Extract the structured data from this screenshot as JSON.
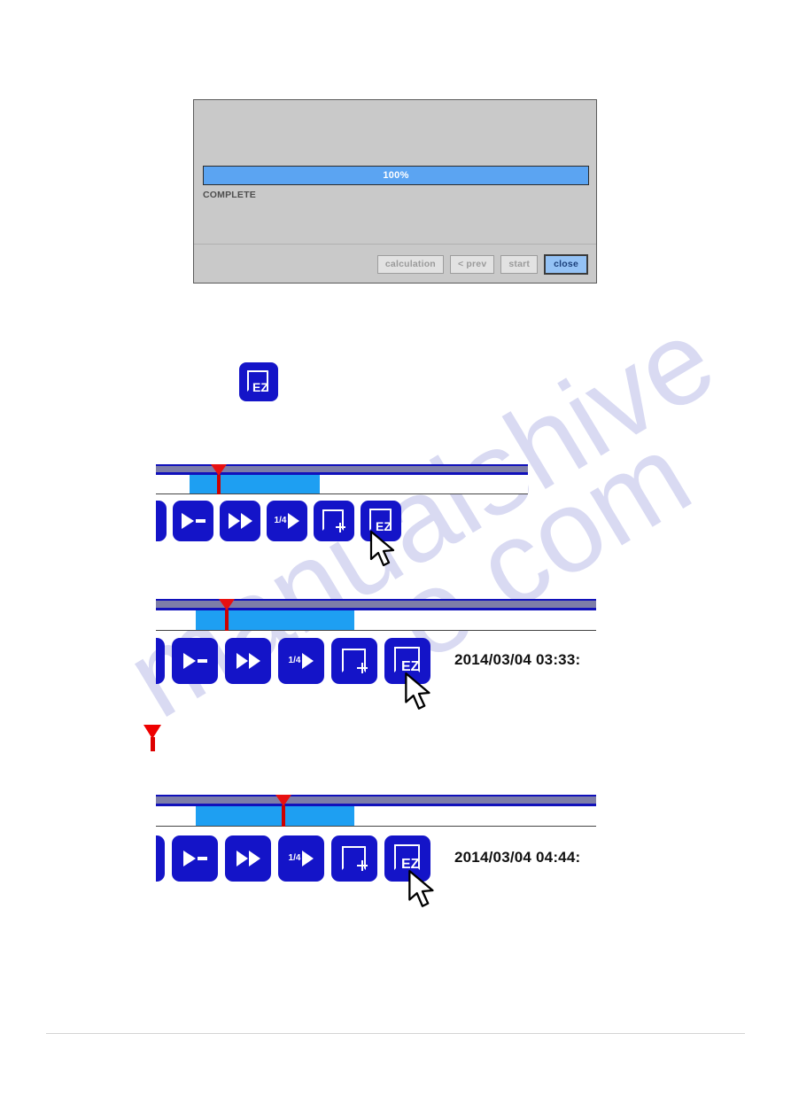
{
  "watermark": {
    "line1": "manualshive",
    "line2": "e.com"
  },
  "dialog": {
    "progress": {
      "percent_label": "100%",
      "percent_value": 100,
      "fill_color": "#5ba4f2"
    },
    "status_text": "COMPLETE",
    "buttons": [
      {
        "label": "calculation",
        "state": "disabled"
      },
      {
        "label": "< prev",
        "state": "disabled"
      },
      {
        "label": "start",
        "state": "disabled"
      },
      {
        "label": "close",
        "state": "focused"
      }
    ]
  },
  "ez_icon": {
    "label": "EZ"
  },
  "toolbars": [
    {
      "id": "toolbar-1",
      "buttons": [
        {
          "name": "play-step-button",
          "glyph": "play-dash-icon",
          "label": ""
        },
        {
          "name": "fast-forward-button",
          "glyph": "fast-forward-icon",
          "label": ""
        },
        {
          "name": "quarter-speed-button",
          "glyph": "quarter-play-icon",
          "label": "1/4"
        },
        {
          "name": "frame-add-button",
          "glyph": "frame-plus-icon",
          "label": "+"
        },
        {
          "name": "ez-button",
          "glyph": "ez-icon",
          "label": "EZ"
        }
      ],
      "timestamp": ""
    },
    {
      "id": "toolbar-2",
      "buttons": [
        {
          "name": "play-step-button",
          "glyph": "play-dash-icon",
          "label": ""
        },
        {
          "name": "fast-forward-button",
          "glyph": "fast-forward-icon",
          "label": ""
        },
        {
          "name": "quarter-speed-button",
          "glyph": "quarter-play-icon",
          "label": "1/4"
        },
        {
          "name": "frame-add-button",
          "glyph": "frame-plus-icon",
          "label": "+"
        },
        {
          "name": "ez-button",
          "glyph": "ez-icon",
          "label": "EZ"
        }
      ],
      "timestamp": "2014/03/04  03:33:"
    },
    {
      "id": "toolbar-3",
      "buttons": [
        {
          "name": "play-step-button",
          "glyph": "play-dash-icon",
          "label": ""
        },
        {
          "name": "fast-forward-button",
          "glyph": "fast-forward-icon",
          "label": ""
        },
        {
          "name": "quarter-speed-button",
          "glyph": "quarter-play-icon",
          "label": "1/4"
        },
        {
          "name": "frame-add-button",
          "glyph": "frame-plus-icon",
          "label": "+"
        },
        {
          "name": "ez-button",
          "glyph": "ez-icon",
          "label": "EZ"
        }
      ],
      "timestamp": "2014/03/04  04:44:"
    }
  ],
  "timelines": [
    {
      "id": "timeline-1",
      "segment_start_pct": 9,
      "segment_width_pct": 35,
      "marker_pct": 17,
      "recorded_color": "#1e9ff2",
      "marker_color": "#e81010"
    },
    {
      "id": "timeline-2",
      "segment_start_pct": 9,
      "segment_width_pct": 36,
      "marker_pct": 16,
      "recorded_color": "#1e9ff2",
      "marker_color": "#e81010"
    },
    {
      "id": "timeline-3",
      "segment_start_pct": 9,
      "segment_width_pct": 36,
      "marker_pct": 29,
      "recorded_color": "#1e9ff2",
      "marker_color": "#e81010"
    }
  ],
  "standalone_marker": {
    "color": "#ee0000"
  }
}
